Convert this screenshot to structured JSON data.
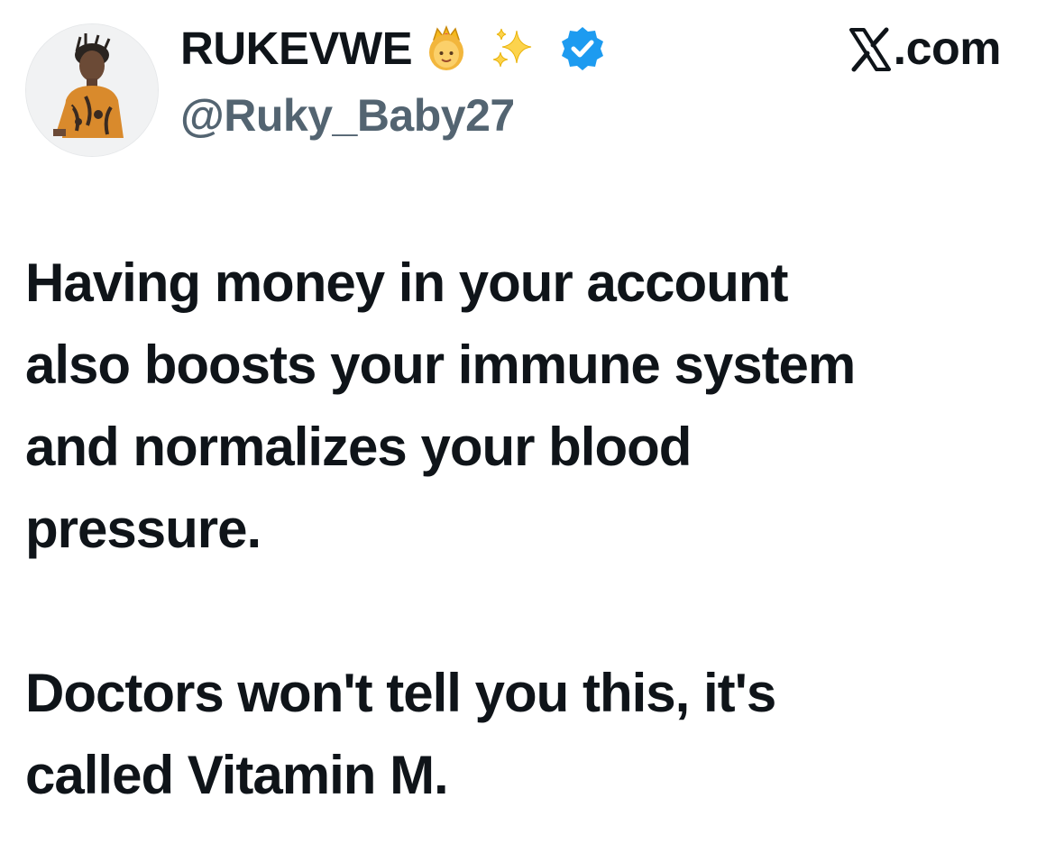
{
  "tweet": {
    "author": {
      "display_name": "RUKEVWE",
      "handle": "@Ruky_Baby27",
      "badges": [
        "princess-emoji",
        "sparkles-emoji",
        "verified-badge-icon"
      ],
      "verified_color": "#1d9bf0"
    },
    "source": {
      "label": ".com",
      "icon": "x-logo-icon"
    },
    "body": {
      "paragraph_1": "Having money in your account\nalso boosts your immune system\nand normalizes your blood\npressure.",
      "paragraph_2": "Doctors won't tell you this, it's\ncalled Vitamin M."
    }
  },
  "colors": {
    "text": "#0f1419",
    "secondary_text": "#536471",
    "background": "#ffffff"
  }
}
